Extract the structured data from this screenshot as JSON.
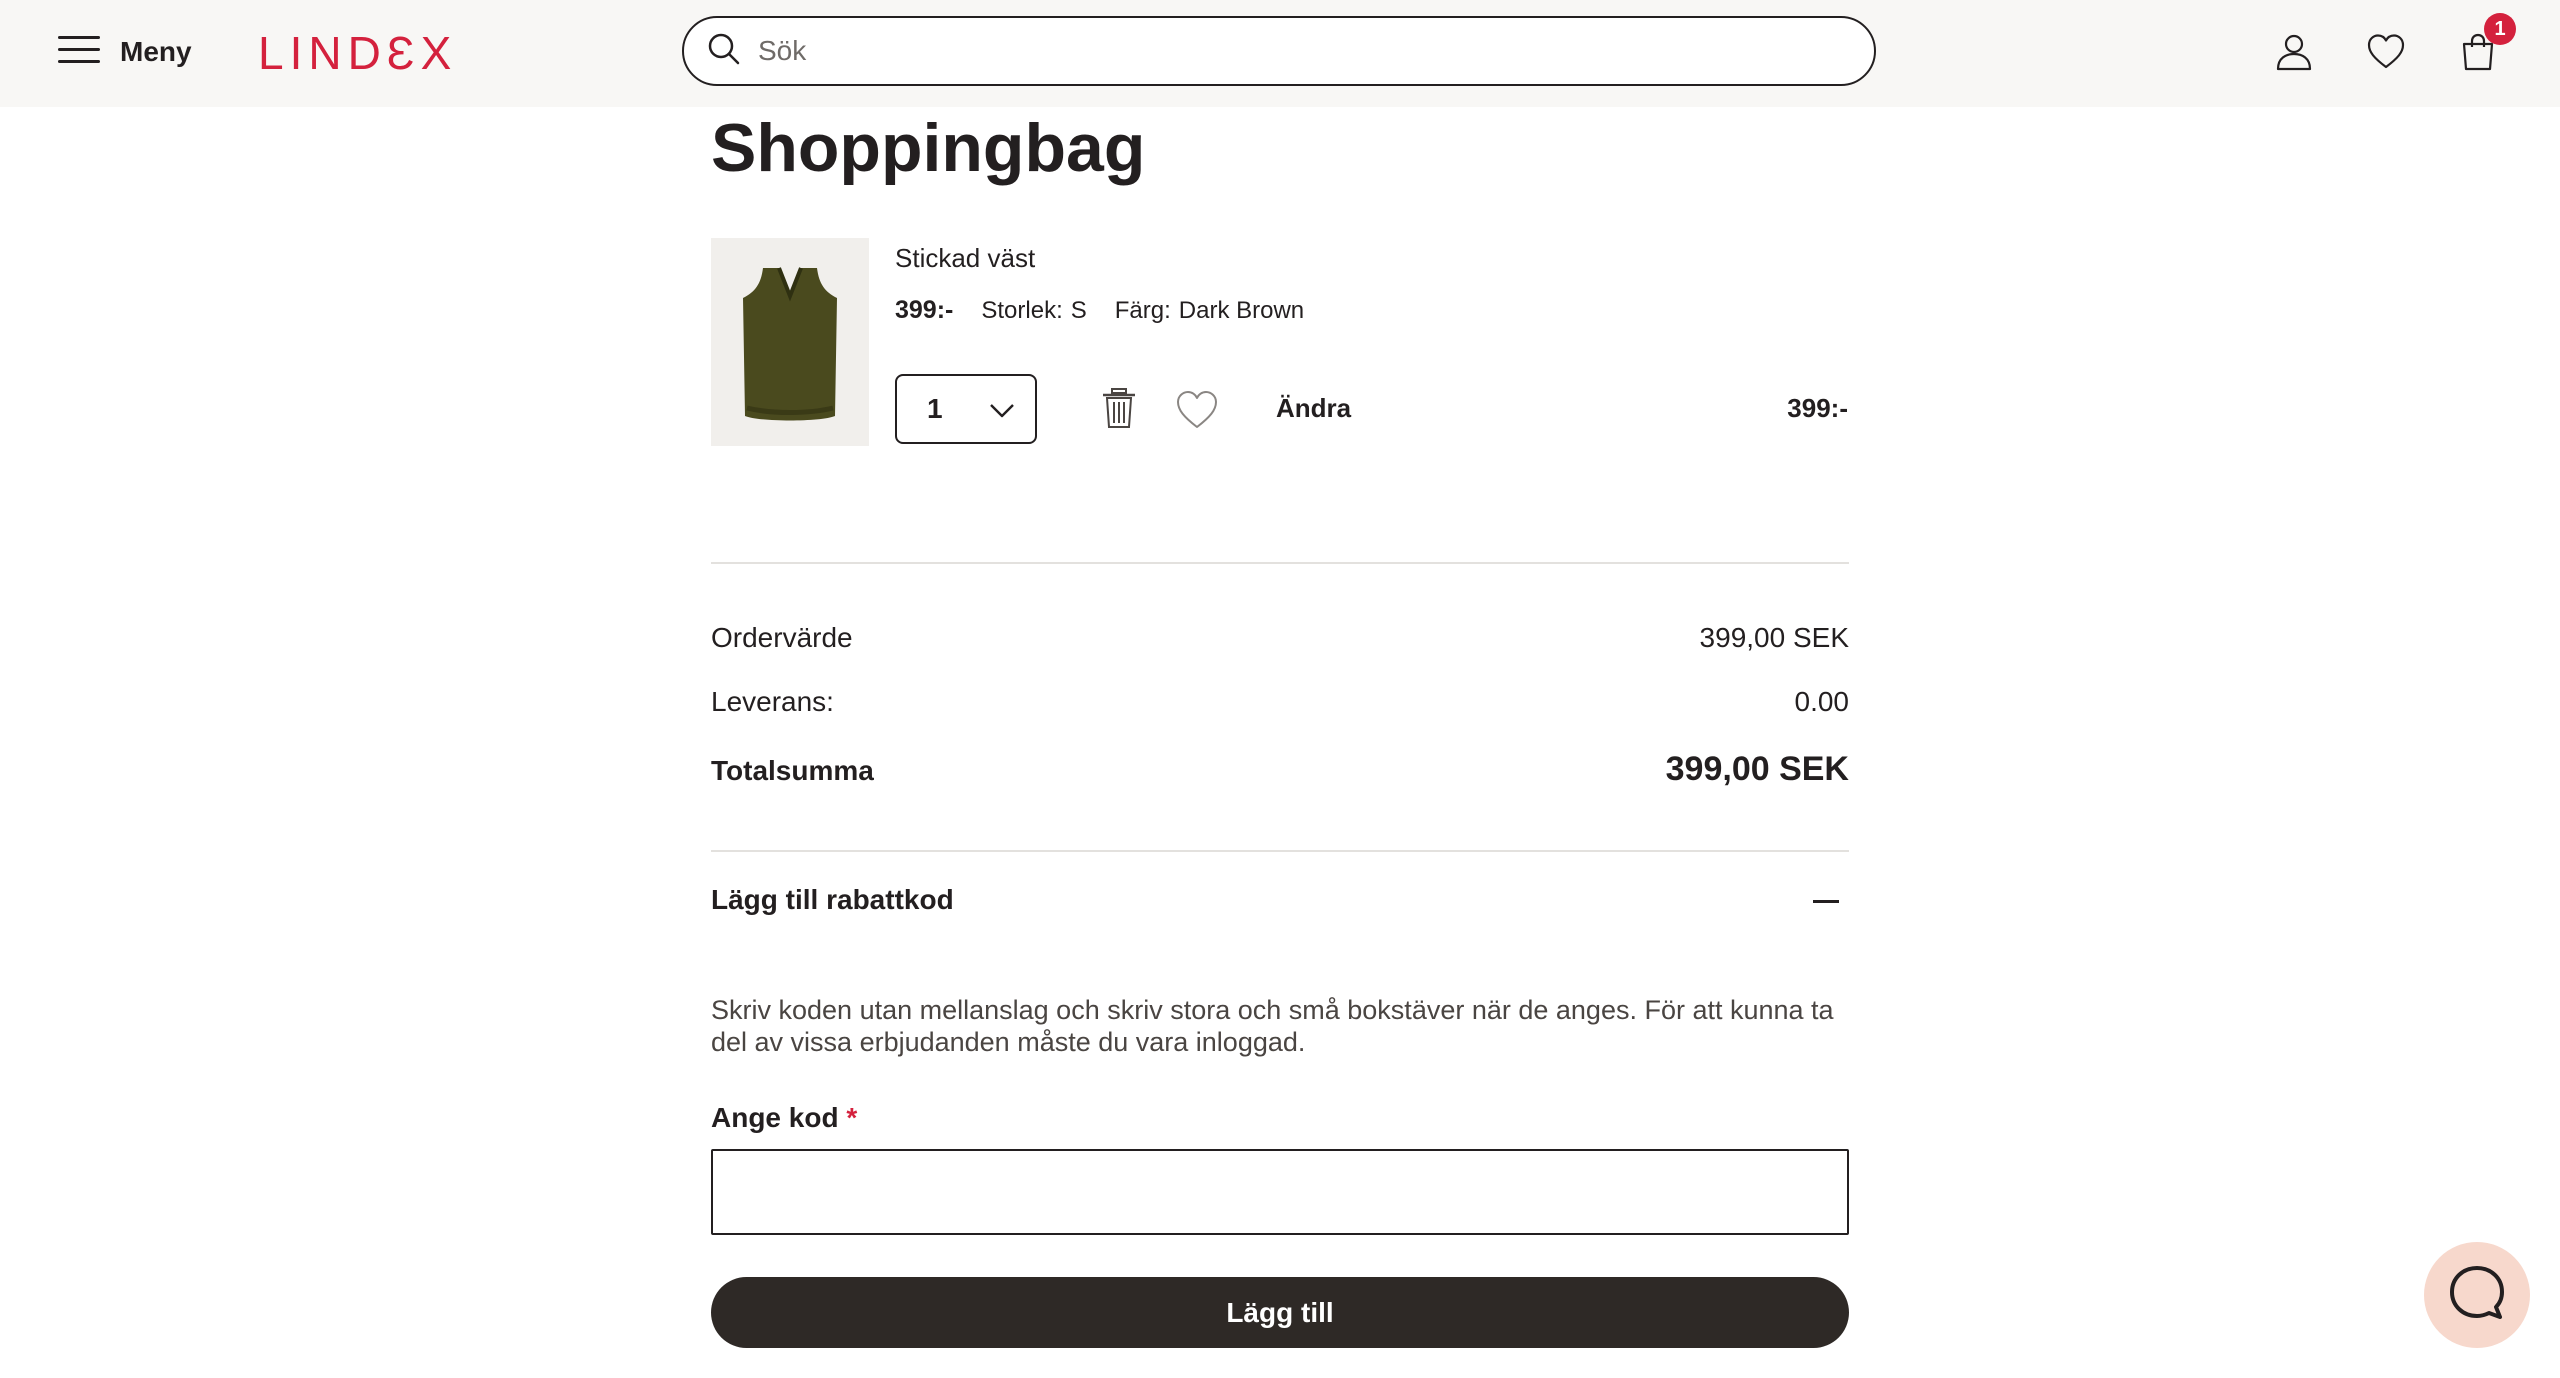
{
  "header": {
    "menu_label": "Meny",
    "logo": "LINDƐX",
    "search_placeholder": "Sök",
    "cart_count": "1",
    "icons": [
      "menu-icon",
      "search-icon",
      "user-icon",
      "heart-icon",
      "bag-icon"
    ]
  },
  "page": {
    "title": "Shoppingbag"
  },
  "cart_item": {
    "name": "Stickad väst",
    "unit_price": "399:-",
    "size_label": "Storlek:",
    "size_value": "S",
    "color_label": "Färg:",
    "color_value": "Dark Brown",
    "quantity": "1",
    "edit_label": "Ändra",
    "line_total": "399:-"
  },
  "summary": {
    "order_value_label": "Ordervärde",
    "order_value": "399,00 SEK",
    "delivery_label": "Leverans:",
    "delivery_value": "0.00",
    "total_label": "Totalsumma",
    "total_value": "399,00 SEK"
  },
  "discount": {
    "toggle_label": "Lägg till rabattkod",
    "helper_text": "Skriv koden utan mellanslag och skriv stora och små bokstäver när de anges. För att kunna ta del av vissa erbjudanden måste du vara inloggad.",
    "code_label": "Ange kod",
    "required_mark": "*",
    "code_value": "",
    "submit_label": "Lägg till"
  },
  "colors": {
    "brand": "#d4213d",
    "text": "#231f20",
    "button_dark": "#2e2926",
    "header_bg": "#f8f7f5",
    "chat_bg": "#f7d8cc"
  }
}
